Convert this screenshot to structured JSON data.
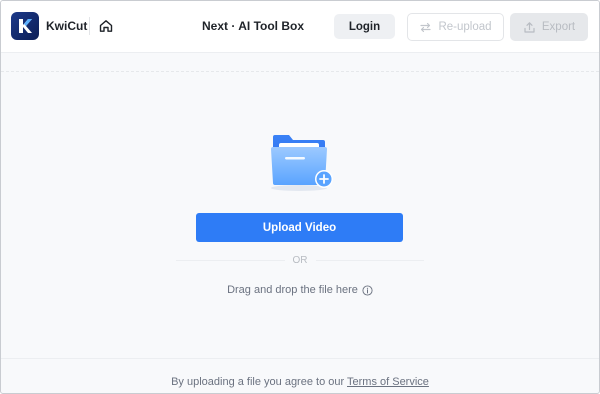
{
  "app": {
    "name": "KwiCut"
  },
  "header": {
    "title": "Next · AI Tool Box",
    "login_label": "Login",
    "reupload_label": "Re-upload",
    "export_label": "Export"
  },
  "upload": {
    "button_label": "Upload Video",
    "or_label": "OR",
    "drag_text": "Drag and drop the file here"
  },
  "footer": {
    "text": "By uploading a file you agree to our ",
    "tos_label": "Terms of Service"
  },
  "colors": {
    "accent": "#2e7cf6",
    "logo": "#1d3a8a"
  },
  "icons": {
    "logo": "kwicut-logo-icon",
    "home": "home-icon",
    "reupload": "swap-arrows-icon",
    "export": "export-icon",
    "folder": "folder-add-icon",
    "info": "info-icon"
  }
}
